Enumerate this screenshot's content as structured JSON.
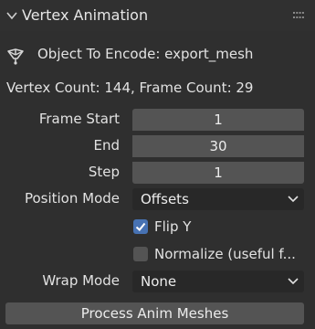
{
  "panel": {
    "title": "Vertex Animation",
    "collapse_icon": "chevron-down-icon",
    "drag_icon": "grip-icon"
  },
  "object": {
    "icon": "armature-object-icon",
    "text": "Object To Encode: export_mesh"
  },
  "counts_text": "Vertex Count: 144, Frame Count: 29",
  "frame": {
    "start_label": "Frame Start",
    "start_value": "1",
    "end_label": "End",
    "end_value": "30",
    "step_label": "Step",
    "step_value": "1"
  },
  "position_mode": {
    "label": "Position Mode",
    "value": "Offsets"
  },
  "flip_y": {
    "label": "Flip Y",
    "checked": true
  },
  "normalize": {
    "label": "Normalize (useful f...",
    "checked": false
  },
  "wrap_mode": {
    "label": "Wrap Mode",
    "value": "None"
  },
  "process_button": "Process Anim Meshes",
  "colors": {
    "background": "#2f2f2f",
    "field": "#545454",
    "dropdown": "#282828",
    "accent": "#4772b3",
    "text": "#e2e2e2"
  }
}
